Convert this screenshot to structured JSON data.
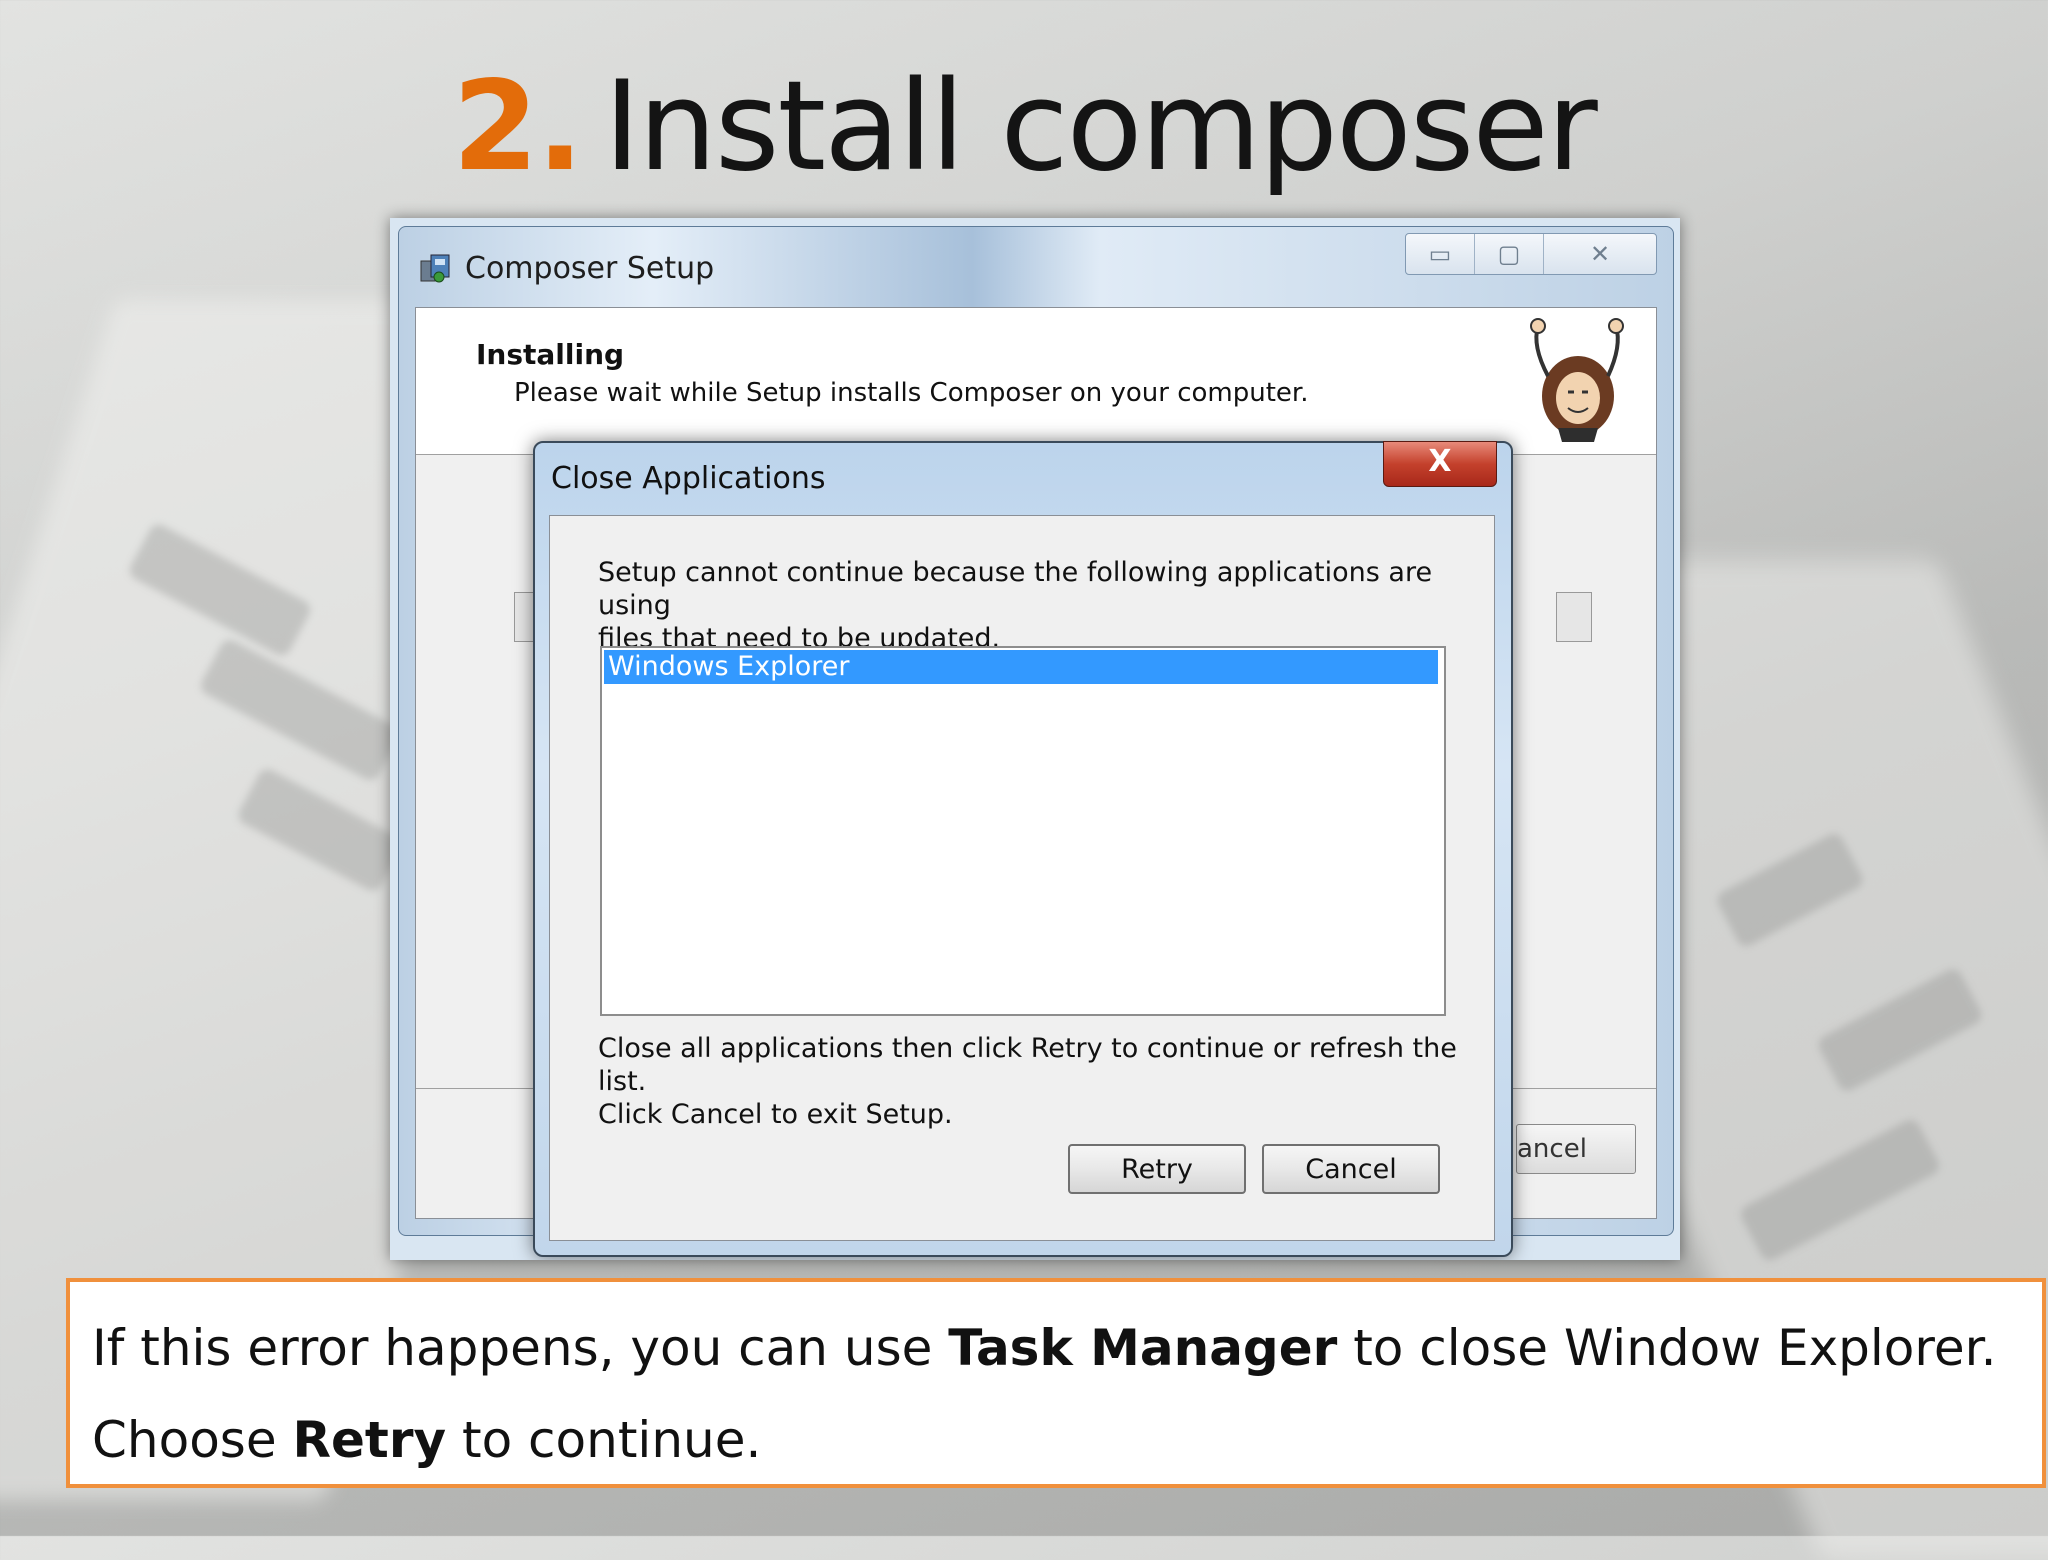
{
  "slide": {
    "title_number": "2.",
    "title_text": "Install composer"
  },
  "setup_window": {
    "title": "Composer Setup",
    "header_title": "Installing",
    "header_subtitle": "Please wait while Setup installs Composer on your computer.",
    "cancel_partial": "ancel",
    "caption_buttons": {
      "minimize": "▭",
      "maximize": "▢",
      "close": "✕"
    }
  },
  "dialog": {
    "title": "Close Applications",
    "close_glyph": "X",
    "message": "Setup cannot continue because the following applications are using\nfiles that need to be updated.",
    "applications": [
      "Windows Explorer"
    ],
    "instructions": "Close all applications then click Retry to continue or refresh the list.\nClick Cancel to exit Setup.",
    "retry_label": "Retry",
    "cancel_label": "Cancel"
  },
  "note": {
    "line1_pre": "If this error happens, you can use ",
    "line1_bold": "Task Manager",
    "line1_post": " to close Window Explorer.",
    "line2_pre": "Choose ",
    "line2_bold": "Retry",
    "line2_post": " to continue."
  },
  "colors": {
    "accent": "#e36c0a",
    "note_border": "#f0903c",
    "selection": "#3399ff"
  }
}
